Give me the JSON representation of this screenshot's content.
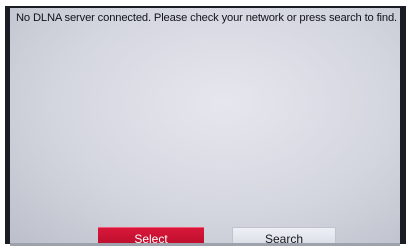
{
  "dialog": {
    "message": "No DLNA server connected. Please check your network or press search to find."
  },
  "buttons": {
    "select_label": "Select",
    "search_label": "Search"
  },
  "colors": {
    "select_button": "#c8102e",
    "search_button": "#e4e6ee",
    "screen_background": "#d9dbe3"
  }
}
